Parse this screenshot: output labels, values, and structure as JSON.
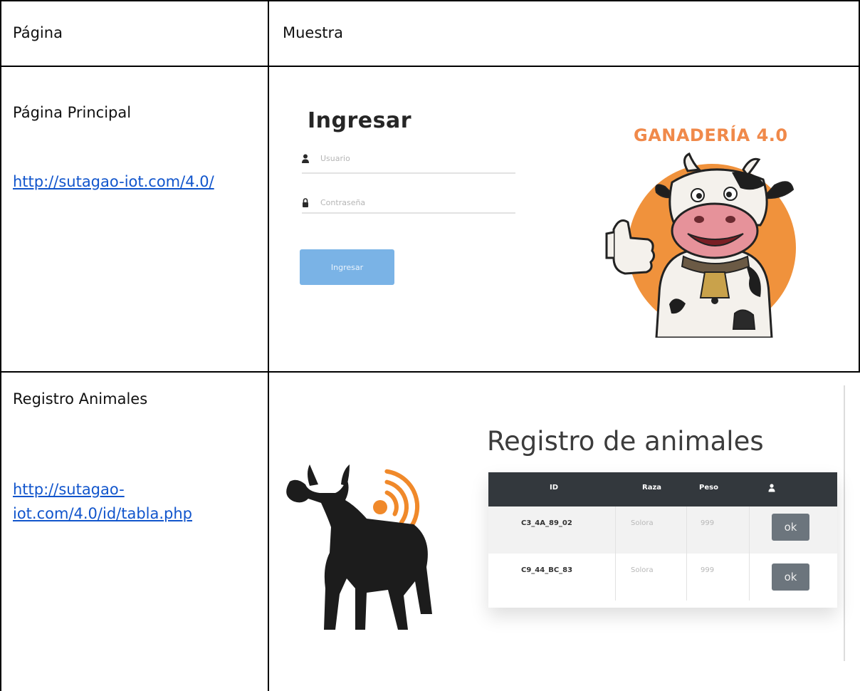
{
  "table": {
    "headers": {
      "col1": "Página",
      "col2": "Muestra"
    },
    "rows": [
      {
        "page_name": "Página Principal",
        "url": "http://sutagao-iot.com/4.0/"
      },
      {
        "page_name": "Registro Animales",
        "url_line1": "http://sutagao-",
        "url_line2": "iot.com/4.0/id/tabla.php"
      }
    ]
  },
  "login_sample": {
    "title": "Ingresar",
    "username_placeholder": "Usuario",
    "password_placeholder": "Contraseña",
    "submit_label": "Ingresar",
    "brand": "GANADERÍA 4.0",
    "icons": {
      "user": "user-icon",
      "lock": "lock-icon",
      "mascot": "cow-mascot-logo"
    }
  },
  "registro_sample": {
    "title": "Registro de animales",
    "columns": [
      "ID",
      "Raza",
      "Peso"
    ],
    "header_icon": "user-icon",
    "rows": [
      {
        "id": "C3_4A_89_02",
        "raza": "Solora",
        "peso": "999",
        "action": "ok"
      },
      {
        "id": "C9_44_BC_83",
        "raza": "Solora",
        "peso": "999",
        "action": "ok"
      }
    ],
    "icons": {
      "logo": "bull-rfid-logo"
    }
  },
  "colors": {
    "link": "#1155cc",
    "brand_orange": "#f0894a",
    "login_button": "#7ab3e6",
    "table_header": "#33383d",
    "ok_button": "#6c757d"
  }
}
